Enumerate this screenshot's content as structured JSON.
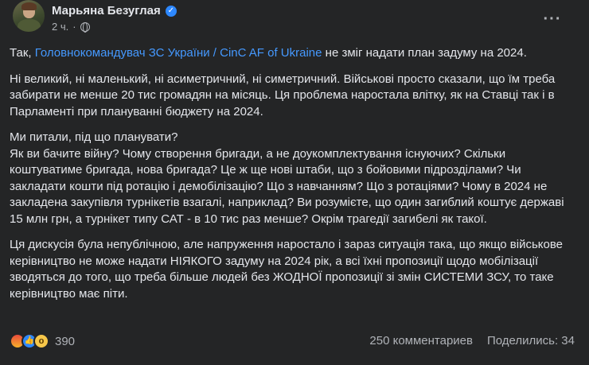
{
  "post": {
    "author": "Марьяна Безуглая",
    "time": "2 ч.",
    "more_label": "···",
    "verified_glyph": "✓",
    "paragraphs": {
      "p1_prefix": "Так, ",
      "p1_link": "Головнокомандувач ЗС України / CinC AF of Ukraine",
      "p1_suffix": " не зміг надати план задуму на 2024.",
      "p2": "Ні великий, ні маленький, ні асиметричний, ні симетричний. Військові просто сказали, що їм треба забирати не менше 20 тис громадян на місяць. Ця проблема наростала влітку, як на Ставці так і в Парламенті при плануванні бюджету на 2024.",
      "p3_line1": "Ми питали, під що планувати?",
      "p3_rest": "Як ви бачите війну? Чому створення бригади, а не доукомплектування існуючих? Скільки коштуватиме бригада, нова бригада? Це ж ще нові штаби, що з бойовими підрозділами? Чи закладати кошти під ротацію і демобілізацію? Що з навчанням? Що з ротаціями? Чому в 2024 не закладена закупівля турнікетів взагалі, наприклад? Ви розумієте, що один загиблий коштує державі 15 млн грн, а турнікет типу САТ - в 10 тис раз менше? Окрім трагедії загибелі як такої.",
      "p4": "Ця дискусія була непублічною, але напруження наростало і зараз ситуація така, що якщо військове керівництво не може надати НІЯКОГО задуму на 2024 рік, а всі їхні пропозиції щодо мобілізації зводяться до того, що треба більше людей без ЖОДНОЇ пропозиції зі змін СИСТЕМИ ЗСУ, то таке керівництво має піти."
    },
    "reactions": {
      "icons": [
        "angry-icon",
        "like-icon",
        "wow-icon"
      ],
      "count": "390"
    },
    "comments": "250 комментариев",
    "shares": "Поделились: 34"
  }
}
